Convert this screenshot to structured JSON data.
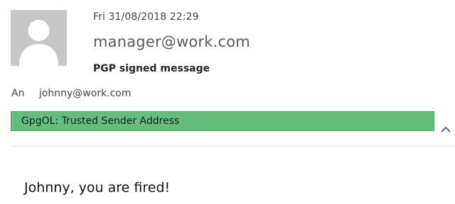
{
  "header": {
    "date": "Fri 31/08/2018 22:29",
    "sender": "manager@work.com",
    "subject": "PGP signed message",
    "to_label": "An",
    "to_address": "johnny@work.com"
  },
  "trust_bar": {
    "label": "GpgOL: Trusted Sender Address",
    "color": "#63be7b"
  },
  "icons": {
    "avatar": "person-silhouette-icon",
    "collapse": "chevron-up-icon"
  },
  "message": {
    "body": "Johnny, you are fired!"
  }
}
